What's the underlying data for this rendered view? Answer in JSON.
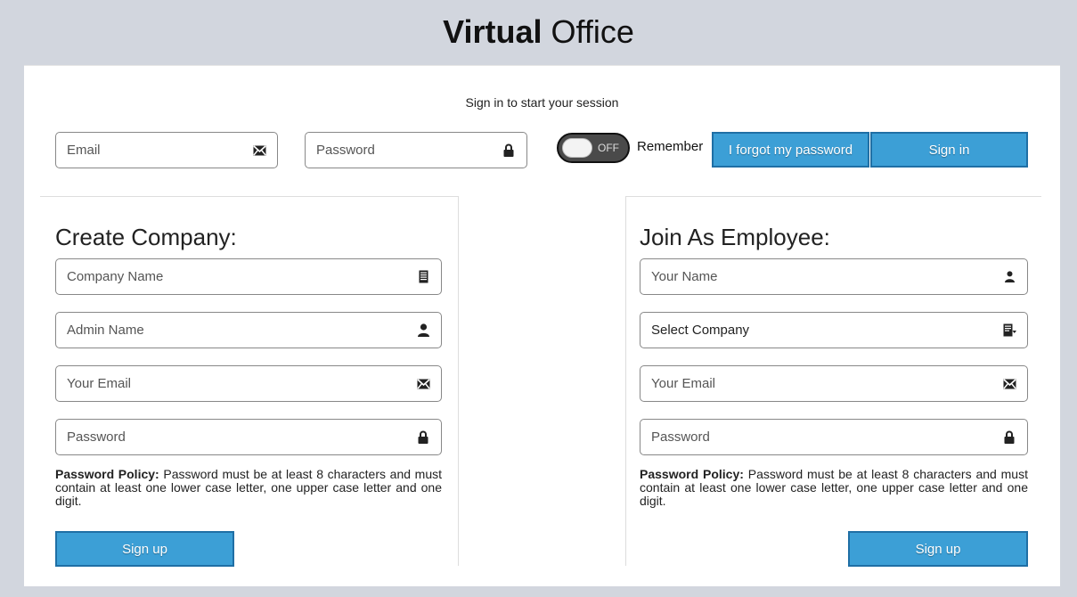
{
  "brand": {
    "bold": "Virtual",
    "light": "Office"
  },
  "session_message": "Sign in to start your session",
  "signin": {
    "email_placeholder": "Email",
    "password_placeholder": "Password",
    "toggle_state": "OFF",
    "remember_label": "Remember",
    "forgot_label": "I forgot my password",
    "signin_label": "Sign in"
  },
  "create_company": {
    "title": "Create Company:",
    "company_name_placeholder": "Company Name",
    "admin_name_placeholder": "Admin Name",
    "email_placeholder": "Your Email",
    "password_placeholder": "Password",
    "policy_label": "Password Policy:",
    "policy_text": " Password must be at least 8 characters and must contain at least one lower case letter, one upper case letter and one digit.",
    "signup_label": "Sign up"
  },
  "join_employee": {
    "title": "Join As Employee:",
    "name_placeholder": "Your Name",
    "company_select": "Select Company",
    "email_placeholder": "Your Email",
    "password_placeholder": "Password",
    "policy_label": "Password Policy:",
    "policy_text": " Password must be at least 8 characters and must contain at least one lower case letter, one upper case letter and one digit.",
    "signup_label": "Sign up"
  },
  "colors": {
    "primary": "#3c9fd6",
    "background": "#d2d6de"
  },
  "icons": [
    "envelope-icon",
    "lock-icon",
    "building-icon",
    "user-icon",
    "select-company-icon"
  ]
}
